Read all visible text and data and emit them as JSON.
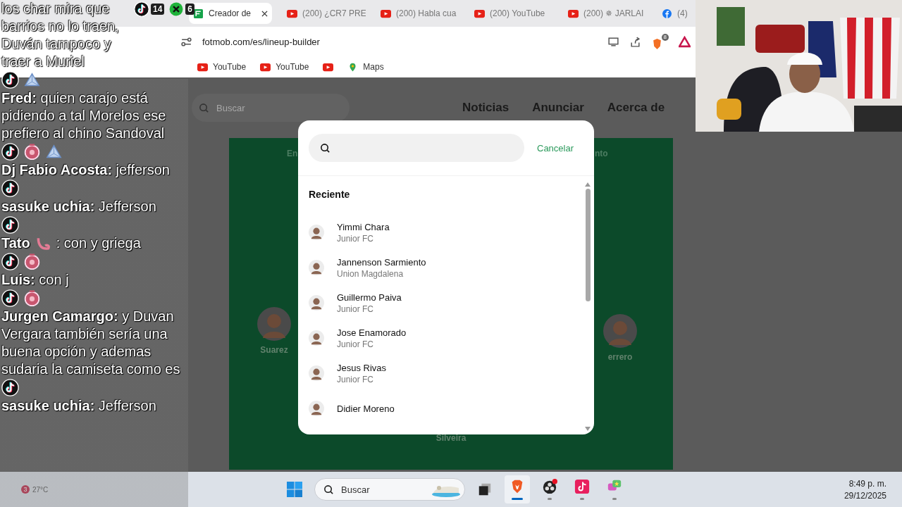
{
  "browser": {
    "tabs": [
      {
        "title": "Creador de",
        "kind": "fotmob",
        "selected": true
      },
      {
        "title": "(200) ¿CR7 PRE",
        "kind": "youtube",
        "selected": false
      },
      {
        "title": "(200) Habla cua",
        "kind": "youtube",
        "selected": false
      },
      {
        "title": "(200) YouTube",
        "kind": "youtube",
        "selected": false
      },
      {
        "title": "(200) ✵ JARLAI",
        "kind": "youtube",
        "selected": false
      },
      {
        "title": "(4)",
        "kind": "facebook",
        "selected": false
      }
    ],
    "address": "fotmob.com/es/lineup-builder",
    "shield_count": "8",
    "bookmarks": [
      {
        "label": "YouTube",
        "kind": "youtube"
      },
      {
        "label": "YouTube",
        "kind": "youtube"
      },
      {
        "kind": "youtube"
      },
      {
        "label": "Maps",
        "kind": "maps"
      }
    ]
  },
  "page": {
    "search_placeholder": "Buscar",
    "nav": [
      "Noticias",
      "Anunciar",
      "Acerca de"
    ],
    "pitch": {
      "labels": [
        "En",
        "nto"
      ],
      "players": [
        {
          "name": "Suarez",
          "photo": true
        },
        {
          "name": "errero",
          "photo": true
        },
        {
          "name": "Silveira",
          "photo": false
        }
      ]
    }
  },
  "modal": {
    "cancel": "Cancelar",
    "section": "Reciente",
    "players": [
      {
        "name": "Yimmi Chara",
        "team": "Junior FC"
      },
      {
        "name": "Jannenson Sarmiento",
        "team": "Union Magdalena"
      },
      {
        "name": "Guillermo Paiva",
        "team": "Junior FC"
      },
      {
        "name": "Jose Enamorado",
        "team": "Junior FC"
      },
      {
        "name": "Jesus Rivas",
        "team": "Junior FC"
      },
      {
        "name": "Didier Moreno"
      }
    ]
  },
  "chat": {
    "counters": [
      {
        "kind": "tiktok",
        "count": "14"
      },
      {
        "kind": "x",
        "count": "6"
      }
    ],
    "messages": [
      {
        "text": "los char mira que barrios no lo traen, Duván tampoco y traer a Muriel"
      },
      {
        "badges": [
          {
            "kind": "tiktok"
          },
          {
            "kind": "triangle"
          }
        ],
        "text": "**Fred:** quien carajo está pidiendo a tal Morelos ese prefiero al chino Sandoval"
      },
      {
        "badges": [
          {
            "kind": "tiktok"
          },
          {
            "kind": "flower"
          },
          {
            "kind": "triangle"
          }
        ],
        "text": "**Dj Fabio Acosta:** jefferson"
      },
      {
        "badges": [
          {
            "kind": "tiktok"
          }
        ],
        "text": "**sasuke uchia:** Jefferson"
      },
      {
        "badges": [
          {
            "kind": "tiktok"
          }
        ],
        "name": "Tato",
        "name_badges": [
          {
            "kind": "swirl"
          }
        ],
        "text": ": con y griega"
      },
      {
        "badges": [
          {
            "kind": "tiktok"
          },
          {
            "kind": "flower"
          }
        ],
        "text": "**Luis:** con j"
      },
      {
        "badges": [
          {
            "kind": "tiktok"
          },
          {
            "kind": "flower"
          }
        ],
        "text": "**Jurgen Camargo:** y Duvan Vergara también sería una buena opción y ademas sudaria la camiseta como es"
      },
      {
        "badges": [
          {
            "kind": "tiktok"
          }
        ],
        "text": "**sasuke uchia:** Jefferson"
      }
    ]
  },
  "taskbar": {
    "weather": {
      "badge": "3",
      "temperature": "27°C"
    },
    "search_placeholder": "Buscar",
    "apps": [
      {
        "kind": "task-view",
        "selected": false,
        "running": false
      },
      {
        "kind": "brave",
        "selected": true,
        "running": true
      },
      {
        "kind": "obs",
        "selected": false,
        "running": true
      },
      {
        "kind": "tiktok",
        "selected": false,
        "running": true
      },
      {
        "kind": "chat",
        "selected": false,
        "running": true
      }
    ],
    "time": "8:49 p. m.",
    "date": "29/12/2025"
  }
}
